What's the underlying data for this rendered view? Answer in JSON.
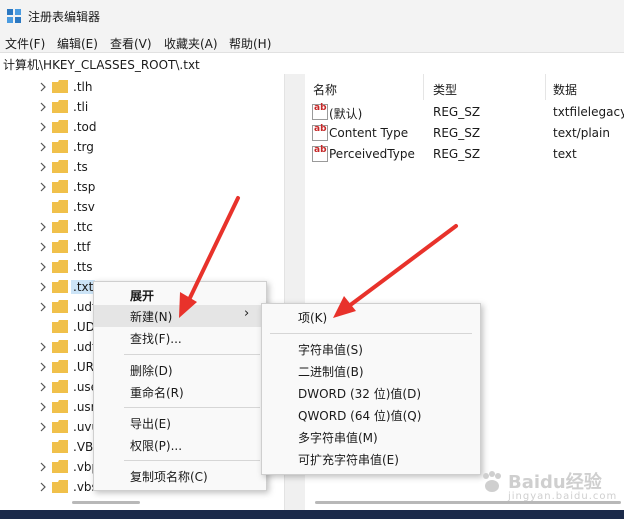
{
  "window": {
    "title": "注册表编辑器"
  },
  "menu": [
    "文件(F)",
    "编辑(E)",
    "查看(V)",
    "收藏夹(A)",
    "帮助(H)"
  ],
  "address": "计算机\\HKEY_CLASSES_ROOT\\.txt",
  "tree": [
    ".tlh",
    ".tli",
    ".tod",
    ".trg",
    ".ts",
    ".tsp",
    ".tsv",
    ".ttc",
    ".ttf",
    ".tts",
    ".txt",
    ".udt",
    ".UD",
    ".udt",
    ".UR",
    ".use",
    ".usr",
    ".uvu",
    ".VB",
    ".vbp",
    ".vbs"
  ],
  "tree_selected": ".txt",
  "columns": {
    "name": "名称",
    "type": "类型",
    "data": "数据"
  },
  "values": [
    {
      "name": "(默认)",
      "type": "REG_SZ",
      "data": "txtfilelegacy"
    },
    {
      "name": "Content Type",
      "type": "REG_SZ",
      "data": "text/plain"
    },
    {
      "name": "PerceivedType",
      "type": "REG_SZ",
      "data": "text"
    }
  ],
  "context_menu": {
    "expand": "展开",
    "new": "新建(N)",
    "find": "查找(F)...",
    "delete": "删除(D)",
    "rename": "重命名(R)",
    "export": "导出(E)",
    "permissions": "权限(P)...",
    "copy_name": "复制项名称(C)",
    "submenu_arrow": "›"
  },
  "submenu": {
    "key": "项(K)",
    "string": "字符串值(S)",
    "binary": "二进制值(B)",
    "dword": "DWORD (32 位)值(D)",
    "qword": "QWORD (64 位)值(Q)",
    "multi_string": "多字符串值(M)",
    "expandable_string": "可扩充字符串值(E)"
  },
  "watermark": {
    "text": "Baidu经验",
    "sub": "jingyan.baidu.com"
  },
  "colors": {
    "folder": "#f0c04a",
    "arrow": "#e8322b",
    "selection": "#cce4f7",
    "highlight": "#e5e5e5"
  }
}
